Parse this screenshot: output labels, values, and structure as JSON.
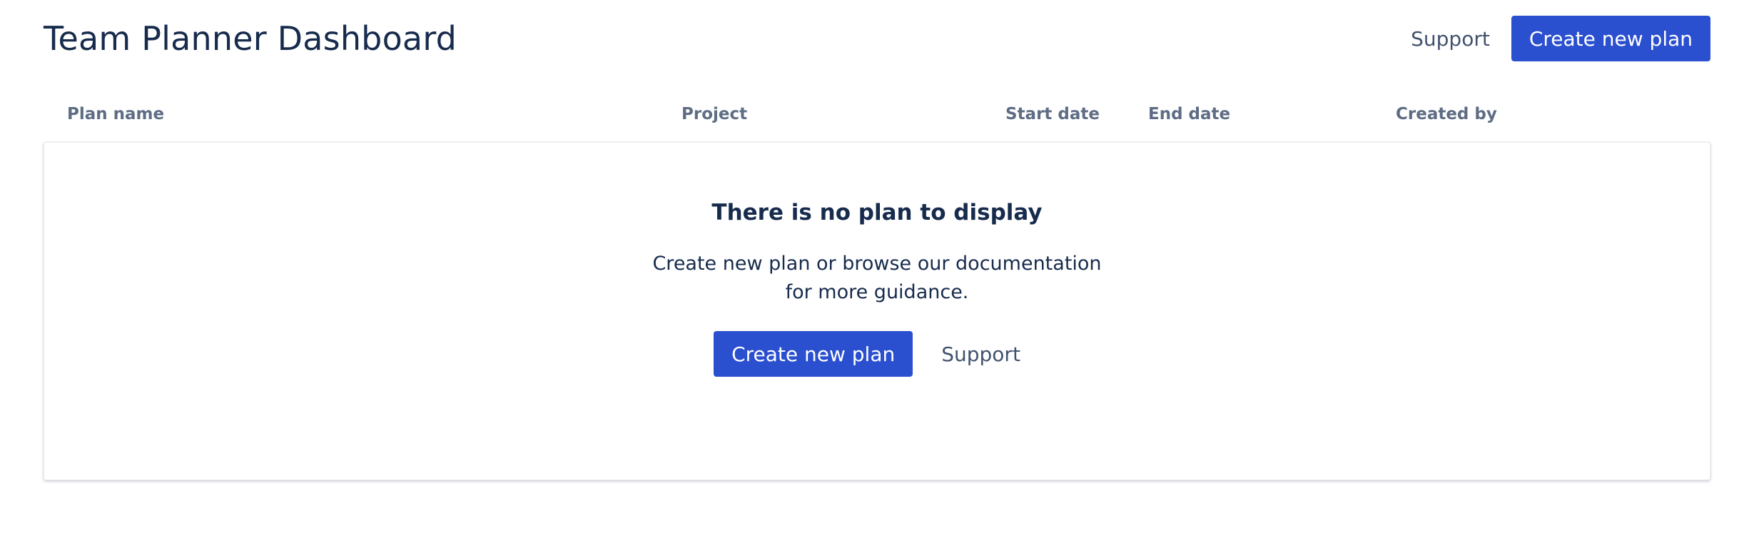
{
  "header": {
    "title": "Team Planner Dashboard",
    "support_label": "Support",
    "create_label": "Create new plan"
  },
  "table": {
    "columns": [
      "Plan name",
      "Project",
      "Start date",
      "End date",
      "Created by"
    ]
  },
  "empty_state": {
    "title": "There is no plan to display",
    "description": "Create new plan or browse our documentation for more guidance.",
    "create_label": "Create new plan",
    "support_label": "Support"
  },
  "colors": {
    "primary": "#2a4fcf",
    "text": "#172b4d",
    "subtle_text": "#5e6c84",
    "link_text": "#42526e"
  }
}
